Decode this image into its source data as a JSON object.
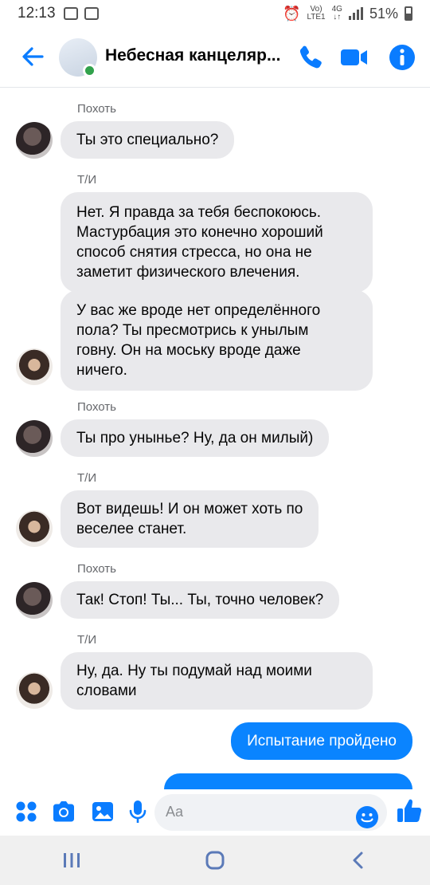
{
  "status_bar": {
    "time": "12:13",
    "network_top": "Vo)",
    "network_bottom": "LTE1",
    "net_4g_top": "4G",
    "net_4g_bottom": "↓↑",
    "battery": "51%"
  },
  "header": {
    "title": "Небесная канцеляр...",
    "icons": [
      "back-arrow-icon",
      "phone-icon",
      "video-camera-icon",
      "info-icon"
    ],
    "accent": "#0a7cff"
  },
  "messages": [
    {
      "sender": "Похоть",
      "text_lines": [
        "Ты это специально?"
      ]
    },
    {
      "sender": "Т/И",
      "text_lines": [
        "Нет. Я правда за тебя беспокоюсь.",
        "Мастурбация это конечно хороший",
        "способ снятия стресса, но она не",
        "заметит физического влечения."
      ]
    },
    {
      "text_lines": [
        "У вас же вроде нет определённого",
        "пола? Ты пресмотрись к унылым",
        "говну. Он на моську вроде даже",
        "ничего."
      ]
    },
    {
      "sender": "Похоть",
      "text_lines": [
        "Ты про унынье? Ну, да он милый)"
      ]
    },
    {
      "sender": "Т/И",
      "text_lines": [
        "Вот видешь! И он может хоть по",
        "веселее станет."
      ]
    },
    {
      "sender": "Похоть",
      "text_lines": [
        "Так! Стоп! Ты... Ты, точно человек?"
      ]
    },
    {
      "sender": "Т/И",
      "text_lines": [
        "Ну, да. Ну ты подумай над моими",
        "словами"
      ]
    },
    {
      "outgoing": true,
      "text_lines": [
        "Испытание пройдено"
      ]
    }
  ],
  "composer": {
    "placeholder": "Aa",
    "icons": [
      "apps-icon",
      "camera-icon",
      "gallery-icon",
      "microphone-icon",
      "emoji-icon",
      "like-icon"
    ]
  },
  "navbar": {
    "icons": [
      "recent-apps-icon",
      "home-icon",
      "back-icon"
    ]
  },
  "colors": {
    "bubble_in": "#e9e9ec",
    "bubble_out": "#0a84ff",
    "online": "#31a24c"
  }
}
